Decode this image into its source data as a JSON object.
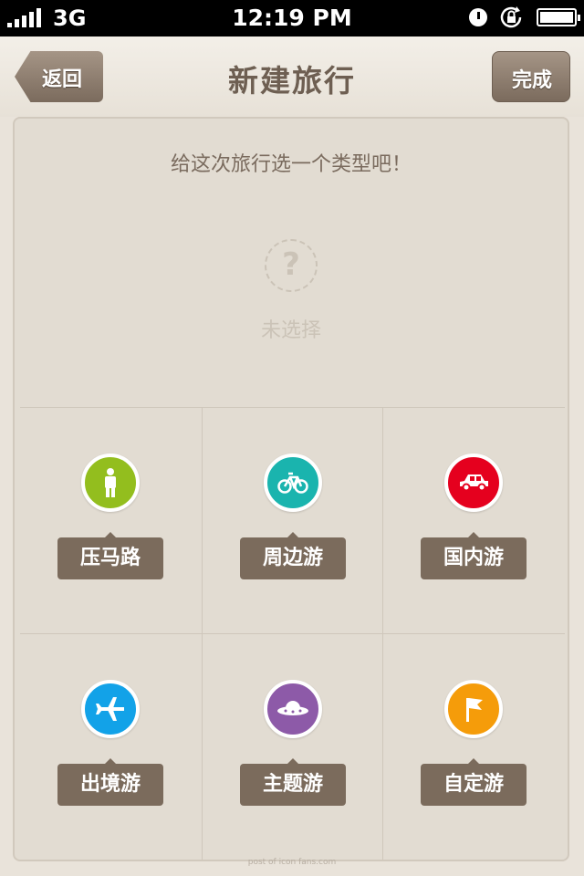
{
  "status_bar": {
    "carrier": "3G",
    "time": "12:19 PM"
  },
  "nav": {
    "back_label": "返回",
    "title": "新建旅行",
    "done_label": "完成"
  },
  "prompt": "给这次旅行选一个类型吧！",
  "selection": {
    "icon": "question-icon",
    "status": "未选择"
  },
  "trip_types": [
    {
      "label": "压马路",
      "icon": "walking-person-icon",
      "color": "#93be1e"
    },
    {
      "label": "周边游",
      "icon": "bicycle-icon",
      "color": "#1ab4ae"
    },
    {
      "label": "国内游",
      "icon": "car-icon",
      "color": "#e5001e"
    },
    {
      "label": "出境游",
      "icon": "airplane-icon",
      "color": "#12a2e8"
    },
    {
      "label": "主题游",
      "icon": "ufo-icon",
      "color": "#8d5aa8"
    },
    {
      "label": "自定游",
      "icon": "flag-icon",
      "color": "#f59c0a"
    }
  ],
  "watermark": "post of icon fans.com"
}
